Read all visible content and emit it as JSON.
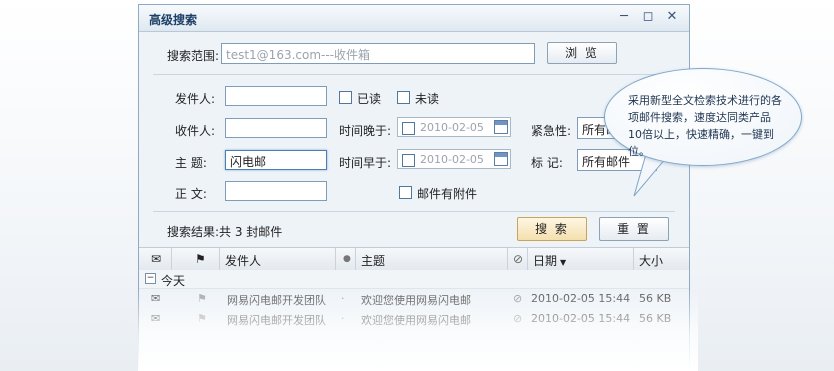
{
  "window": {
    "title": "高级搜索"
  },
  "scope": {
    "label": "搜索范围:",
    "value": "test1@163.com---收件箱",
    "browse_label": "浏  览"
  },
  "form": {
    "sender_label": "发件人:",
    "recipient_label": "收件人:",
    "subject_label": "主  题:",
    "subject_value": "闪电邮",
    "body_label": "正  文:",
    "read_label": "已读",
    "unread_label": "未读",
    "time_after_label": "时间晚于:",
    "time_before_label": "时间早于:",
    "date_after": "2010-02-05",
    "date_before": "2010-02-05",
    "urgency_label": "紧急性:",
    "urgency_value": "所有邮件",
    "mark_label": "标  记:",
    "mark_value": "所有邮件",
    "attachment_label": "邮件有附件"
  },
  "results": {
    "summary": "搜索结果:共 3 封邮件",
    "search_label": "搜  索",
    "reset_label": "重  置"
  },
  "table": {
    "headers": {
      "sender": "发件人",
      "subject": "主题",
      "date": "日期",
      "size": "大小"
    },
    "group": "今天",
    "rows": [
      {
        "sender": "网易闪电邮开发团队",
        "subject": "欢迎您使用网易闪电邮",
        "date": "2010-02-05  15:44",
        "size": "56 KB"
      },
      {
        "sender": "网易闪电邮开发团队",
        "subject": "欢迎您使用网易闪电邮",
        "date": "2010-02-05  15:44",
        "size": "56 KB"
      }
    ]
  },
  "tooltip": {
    "text": "采用新型全文检索技术进行的各项邮件搜索，速度达同类产品10倍以上，快速精确，一键到位。"
  }
}
